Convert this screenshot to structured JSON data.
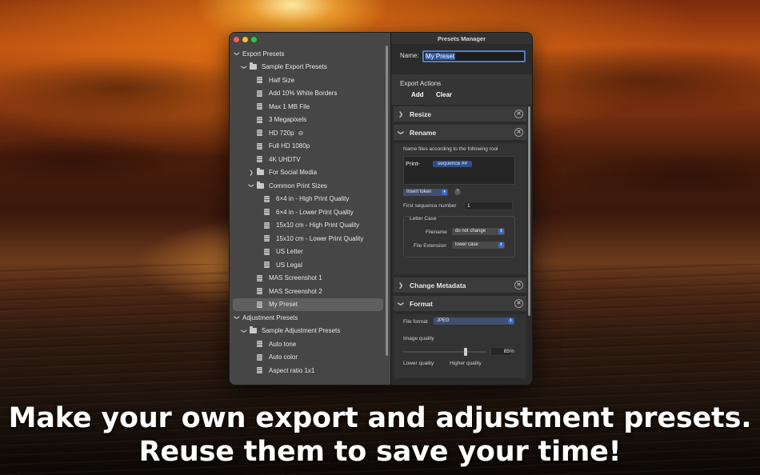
{
  "background": {
    "accent_sun": "#ffcf5a",
    "sea": "#2e1a10"
  },
  "window": {
    "title": "Presets Manager",
    "traffic_lights": [
      "close",
      "minimize",
      "zoom"
    ],
    "colors": {
      "selection": "#5f5f5f",
      "focus_ring": "#4f80c8",
      "token": "#2e4f8e"
    }
  },
  "sidebar": {
    "items": [
      {
        "label": "Export Presets",
        "type": "group",
        "expanded": true
      },
      {
        "label": "Sample Export Presets",
        "type": "folder",
        "expanded": true
      },
      {
        "label": "Half Size",
        "type": "preset"
      },
      {
        "label": "Add 10% White Borders",
        "type": "preset"
      },
      {
        "label": "Max 1 MB File",
        "type": "preset"
      },
      {
        "label": "3 Megapixels",
        "type": "preset"
      },
      {
        "label": "HD 720p",
        "type": "preset",
        "badge": "⊖"
      },
      {
        "label": "Full HD 1080p",
        "type": "preset"
      },
      {
        "label": "4K UHDTV",
        "type": "preset"
      },
      {
        "label": "For Social Media",
        "type": "folder",
        "expanded": false
      },
      {
        "label": "Common Print Sizes",
        "type": "folder",
        "expanded": true
      },
      {
        "label": "6×4 in - High Print Quality",
        "type": "preset"
      },
      {
        "label": "6×4 in - Lower Print Quality",
        "type": "preset"
      },
      {
        "label": "15x10 cm - High Print Quality",
        "type": "preset"
      },
      {
        "label": "15x10 cm - Lower Print Quality",
        "type": "preset"
      },
      {
        "label": "US Letter",
        "type": "preset"
      },
      {
        "label": "US Legal",
        "type": "preset"
      },
      {
        "label": "MAS Screenshot 1",
        "type": "preset"
      },
      {
        "label": "MAS Screenshot 2",
        "type": "preset"
      },
      {
        "label": "My Preset",
        "type": "preset",
        "selected": true
      },
      {
        "label": "Adjustment Presets",
        "type": "group",
        "expanded": true
      },
      {
        "label": "Sample Adjustment Presets",
        "type": "folder",
        "expanded": true
      },
      {
        "label": "Auto tone",
        "type": "preset"
      },
      {
        "label": "Auto color",
        "type": "preset"
      },
      {
        "label": "Aspect ratio 1x1",
        "type": "preset"
      }
    ]
  },
  "name_field": {
    "label": "Name:",
    "value": "My Preset"
  },
  "export_actions": {
    "title": "Export Actions",
    "add": "Add",
    "clear": "Clear"
  },
  "sections": {
    "resize": {
      "title": "Resize",
      "expanded": false
    },
    "rename": {
      "title": "Rename",
      "expanded": true,
      "description": "Name files according to the following rool",
      "pattern_text": "Print-",
      "token": "sequence ##",
      "insert_token": "Insert token",
      "help": "?",
      "first_sequence_label": "First sequence number",
      "first_sequence_value": "1",
      "letter_case": {
        "title": "Letter Case",
        "filename_label": "Filename",
        "filename_value": "do not change",
        "extension_label": "File Extension",
        "extension_value": "lower case"
      }
    },
    "metadata": {
      "title": "Change Metadata",
      "expanded": false
    },
    "format": {
      "title": "Format",
      "expanded": true,
      "file_format_label": "File format",
      "file_format_value": "JPEG",
      "quality_label": "Image quality",
      "quality_value": "85",
      "quality_unit": "%",
      "quality_fraction": 0.85,
      "low_label": "Lower quality",
      "high_label": "Higher quality"
    }
  },
  "caption": {
    "line1": "Make your own export and adjustment presets.",
    "line2": "Reuse them to save your time!"
  }
}
